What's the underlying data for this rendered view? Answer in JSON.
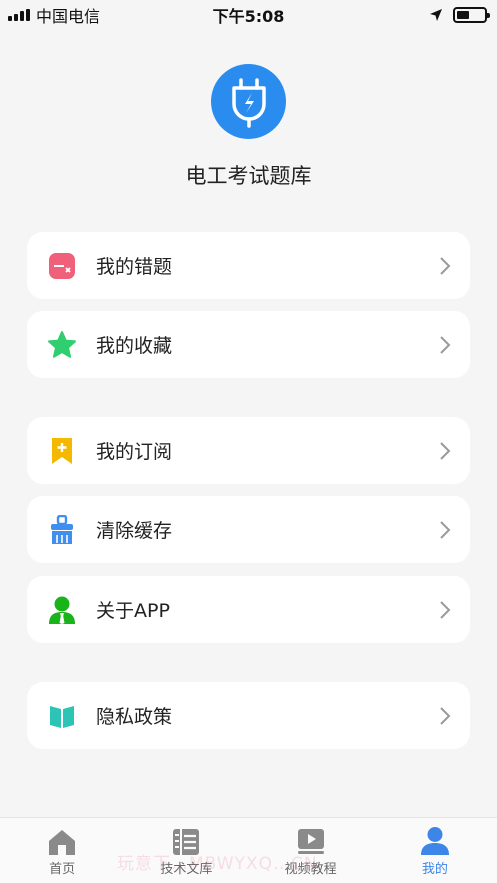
{
  "status_bar": {
    "carrier": "中国电信",
    "time": "下午5:08",
    "battery_level": 0.45
  },
  "app": {
    "title": "电工考试题库",
    "logo_icon": "plug-icon",
    "logo_color": "#2b8cef"
  },
  "menu": [
    {
      "label": "我的错题",
      "icon": "wrong-questions-icon",
      "color": "#f0607a"
    },
    {
      "label": "我的收藏",
      "icon": "star-icon",
      "color": "#2fcf6f"
    },
    {
      "label": "我的订阅",
      "icon": "bookmark-add-icon",
      "color": "#f5b800"
    },
    {
      "label": "清除缓存",
      "icon": "broom-icon",
      "color": "#3f8ef0"
    },
    {
      "label": "关于APP",
      "icon": "user-tie-icon",
      "color": "#1ab31a"
    },
    {
      "label": "隐私政策",
      "icon": "book-icon",
      "color": "#2cc5b5"
    }
  ],
  "tabs": [
    {
      "label": "首页",
      "icon": "home-icon",
      "active": false
    },
    {
      "label": "技术文库",
      "icon": "library-icon",
      "active": false
    },
    {
      "label": "视频教程",
      "icon": "video-icon",
      "active": false
    },
    {
      "label": "我的",
      "icon": "person-icon",
      "active": true
    }
  ],
  "colors": {
    "accent": "#3d86e8",
    "background": "#f5f5f5",
    "inactive_tab": "#8a8a8a"
  },
  "watermark": "玩意下…MBWYXQ…CN"
}
